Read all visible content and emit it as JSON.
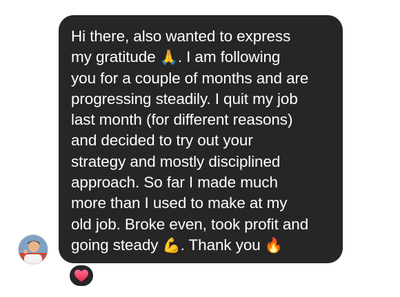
{
  "message": {
    "lines": [
      {
        "text": "Hi there, also wanted to express"
      },
      {
        "before": "my gratitude ",
        "emoji": "🙏",
        "after": ". I am following"
      },
      {
        "text": "you for a couple of months and are"
      },
      {
        "text": "progressing steadily. I quit my job"
      },
      {
        "text": "last month (for different reasons)"
      },
      {
        "text": "and decided to try out your"
      },
      {
        "text": "strategy and mostly disciplined"
      },
      {
        "text": "approach. So far I made much"
      },
      {
        "text": "more than I used to make at my"
      },
      {
        "text": "old job. Broke even, took profit and"
      },
      {
        "before": "going steady ",
        "emoji": "💪",
        "after": ". Thank you ",
        "emoji2": "🔥"
      }
    ]
  },
  "reaction": {
    "icon": "heart-icon",
    "color": "#ff3b5c"
  },
  "sender": {
    "avatar_icon": "avatar"
  },
  "colors": {
    "bubble": "#262626",
    "text": "#ffffff",
    "background": "#ffffff"
  }
}
